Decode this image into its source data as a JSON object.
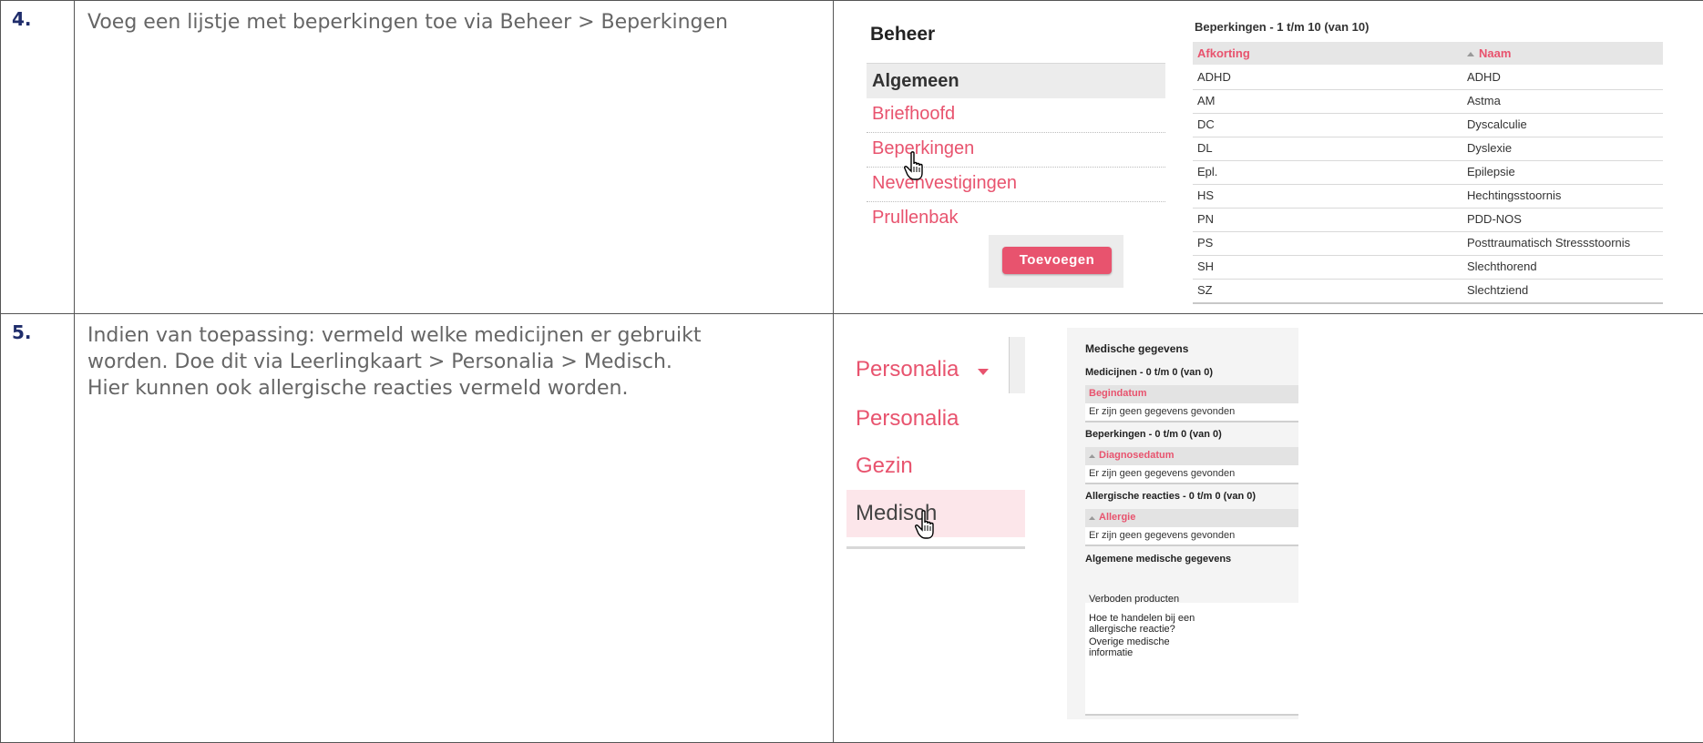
{
  "rows": [
    {
      "number": "4.",
      "text": [
        "Voeg een lijstje met beperkingen toe via Beheer > Beperkingen"
      ]
    },
    {
      "number": "5.",
      "text": [
        "Indien van toepassing: vermeld welke medicijnen er gebruikt",
        "worden. Doe dit via Leerlingkaart > Personalia > Medisch.",
        "Hier kunnen ook allergische reacties vermeld worden."
      ]
    }
  ],
  "beheer": {
    "title": "Beheer",
    "group": "Algemeen",
    "items": [
      "Briefhoofd",
      "Beperkingen",
      "Nevenvestigingen",
      "Prullenbak"
    ],
    "button": "Toevoegen"
  },
  "beperkingen": {
    "caption": "Beperkingen - 1 t/m 10 (van 10)",
    "col1": "Afkorting",
    "col2": "Naam",
    "sort_icon": "sort-up-triangle",
    "rows": [
      [
        "ADHD",
        "ADHD"
      ],
      [
        "AM",
        "Astma"
      ],
      [
        "DC",
        "Dyscalculie"
      ],
      [
        "DL",
        "Dyslexie"
      ],
      [
        "Epl.",
        "Epilepsie"
      ],
      [
        "HS",
        "Hechtingsstoornis"
      ],
      [
        "PN",
        "PDD-NOS"
      ],
      [
        "PS",
        "Posttraumatisch Stressstoornis"
      ],
      [
        "SH",
        "Slechthorend"
      ],
      [
        "SZ",
        "Slechtziend"
      ]
    ]
  },
  "personalia": {
    "tab": "Personalia",
    "items": [
      "Personalia",
      "Gezin",
      "Medisch"
    ]
  },
  "medisch": {
    "title": "Medische gegevens",
    "sections": [
      {
        "caption": "Medicijnen - 0 t/m 0 (van 0)",
        "header": "Begindatum",
        "empty": "Er zijn geen gegevens gevonden"
      },
      {
        "caption": "Beperkingen - 0 t/m 0 (van 0)",
        "header": "Diagnosedatum",
        "empty": "Er zijn geen gegevens gevonden"
      },
      {
        "caption": "Allergische reacties - 0 t/m 0 (van 0)",
        "header": "Allergie",
        "empty": "Er zijn geen gegevens gevonden"
      }
    ],
    "algemeen": "Algemene medische gegevens",
    "fields": [
      "Verboden producten",
      "Hoe te handelen bij een allergische reactie?",
      "Overige medische informatie"
    ]
  },
  "colors": {
    "accent": "#e8536e",
    "number": "#1f2d6b"
  }
}
